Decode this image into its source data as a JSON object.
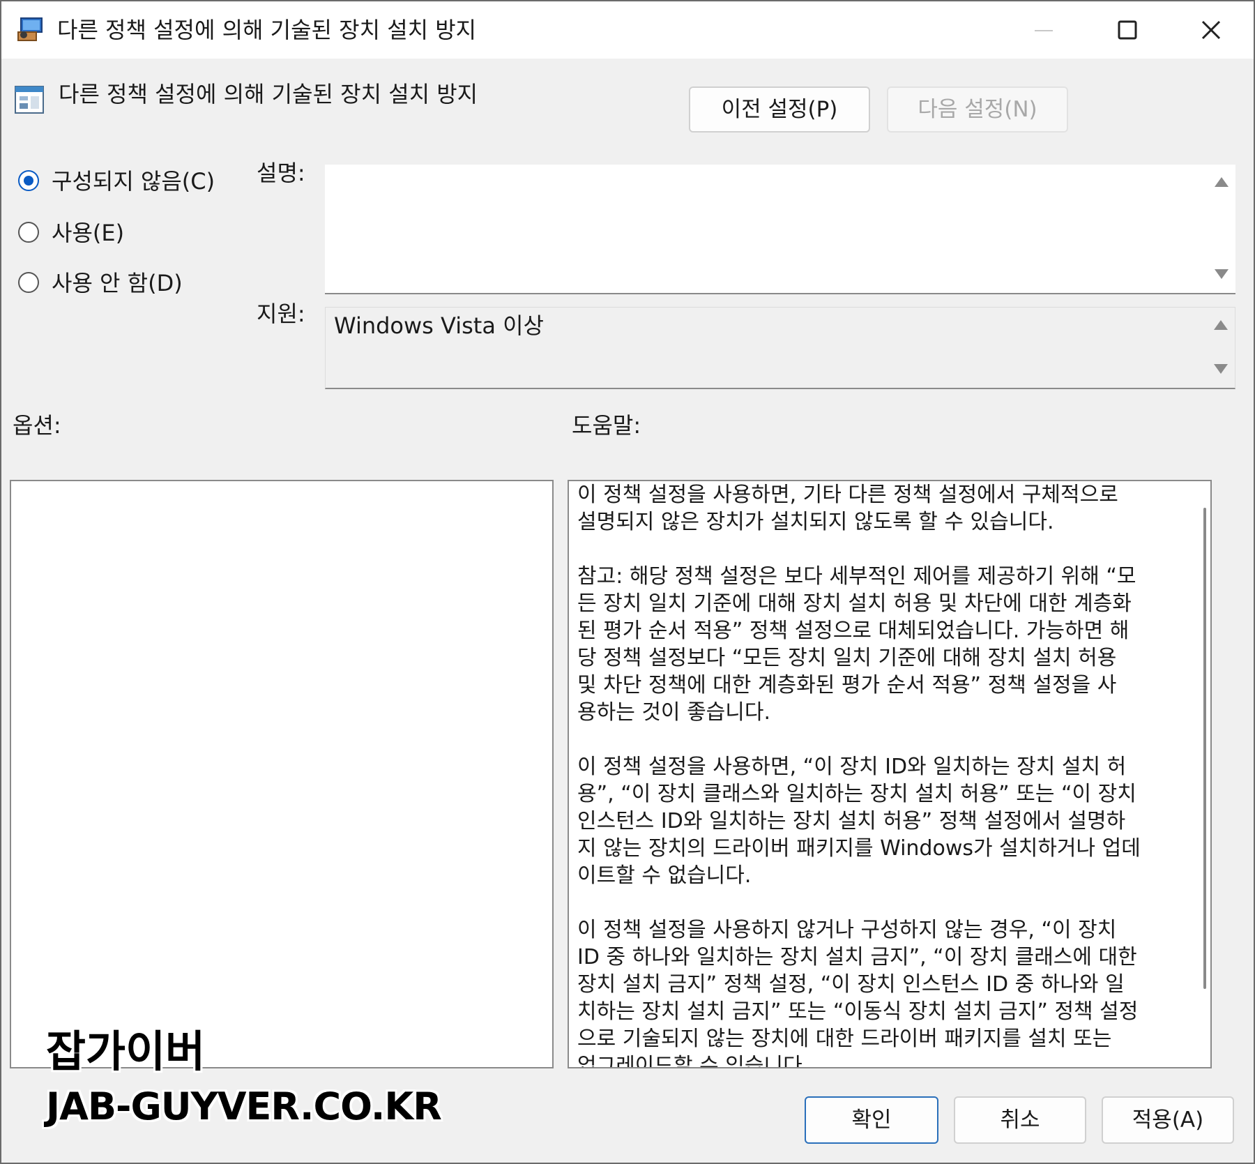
{
  "window": {
    "title": "다른 정책 설정에 의해 기술된 장치 설치 방지",
    "controls": [
      "minimize-icon",
      "maximize-icon",
      "close-icon"
    ]
  },
  "header": {
    "policy_title": "다른 정책 설정에 의해 기술된 장치 설치 방지",
    "prev_button": "이전 설정(P)",
    "next_button": "다음 설정(N)"
  },
  "state": {
    "options": [
      {
        "label": "구성되지 않음(C)",
        "checked": true
      },
      {
        "label": "사용(E)",
        "checked": false
      },
      {
        "label": "사용 안 함(D)",
        "checked": false
      }
    ]
  },
  "comment": {
    "label": "설명:",
    "value": ""
  },
  "supported": {
    "label": "지원:",
    "value": "Windows Vista 이상"
  },
  "options_section": {
    "label": "옵션:"
  },
  "help_section": {
    "label": "도움말:",
    "text": "이 정책 설정을 사용하면, 기타 다른 정책 설정에서 구체적으로\n설명되지 않은 장치가 설치되지 않도록 할 수 있습니다.\n\n참고: 해당 정책 설정은 보다 세부적인 제어를 제공하기 위해 “모\n든 장치 일치 기준에 대해 장치 설치 허용 및 차단에 대한 계층화\n된 평가 순서 적용” 정책 설정으로 대체되었습니다. 가능하면 해\n당 정책 설정보다 “모든 장치 일치 기준에 대해 장치 설치 허용\n및 차단 정책에 대한 계층화된 평가 순서 적용” 정책 설정을 사\n용하는 것이 좋습니다.\n\n이 정책 설정을 사용하면, “이 장치 ID와 일치하는 장치 설치 허\n용”, “이 장치 클래스와 일치하는 장치 설치 허용” 또는 “이 장치\n인스턴스 ID와 일치하는 장치 설치 허용” 정책 설정에서 설명하\n지 않는 장치의 드라이버 패키지를 Windows가 설치하거나 업데\n이트할 수 없습니다.\n\n이 정책 설정을 사용하지 않거나 구성하지 않는 경우, “이 장치\nID 중 하나와 일치하는 장치 설치 금지”, “이 장치 클래스에 대한\n장치 설치 금지” 정책 설정, “이 장치 인스턴스 ID 중 하나와 일\n치하는 장치 설치 금지” 또는 “이동식 장치 설치 금지” 정책 설정\n으로 기술되지 않는 장치에 대한 드라이버 패키지를 설치 또는\n업그레이드할 수 있습니다."
  },
  "footer": {
    "ok": "확인",
    "cancel": "취소",
    "apply": "적용(A)"
  },
  "watermark": {
    "line1": "잡가이버",
    "line2": "JAB-GUYVER.CO.KR"
  },
  "colors": {
    "accent": "#0a5bc4",
    "primary_border": "#2a6fba"
  }
}
